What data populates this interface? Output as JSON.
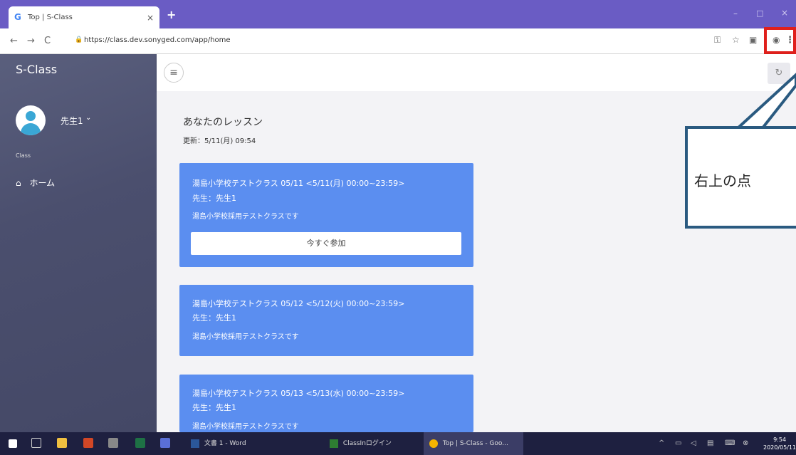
{
  "browser": {
    "tab_title": "Top | S-Class",
    "tab_favicon": "G",
    "tab_close": "×",
    "new_tab": "+",
    "url": "https://class.dev.sonyged.com/app/home",
    "minimize": "–",
    "maximize": "□",
    "close": "×"
  },
  "sidebar": {
    "brand": "S-Class",
    "username": "先生1",
    "caret": "⌄",
    "section": "Class",
    "items": [
      {
        "label": "ホーム",
        "icon": "home-icon"
      }
    ]
  },
  "main": {
    "title": "あなたのレッスン",
    "updated": "更新：5/11(月) 09:54",
    "cards": [
      {
        "title": "湯島小学校テストクラス 05/11 <5/11(月) 00:00~23:59>",
        "teacher": "先生：先生1",
        "desc": "湯島小学校採用テストクラスです",
        "join": "今すぐ参加"
      },
      {
        "title": "湯島小学校テストクラス 05/12 <5/12(火) 00:00~23:59>",
        "teacher": "先生：先生1",
        "desc": "湯島小学校採用テストクラスです"
      },
      {
        "title": "湯島小学校テストクラス 05/13 <5/13(水) 00:00~23:59>",
        "teacher": "先生：先生1",
        "desc": "湯島小学校採用テストクラスです"
      }
    ]
  },
  "callout": {
    "text": "右上の点"
  },
  "taskbar": {
    "items": [
      {
        "label": "文書 1 - Word"
      },
      {
        "label": "ClassInログイン"
      },
      {
        "label": "Top | S-Class - Goo..."
      }
    ],
    "time": "9:54",
    "date": "2020/05/11"
  },
  "colors": {
    "accent": "#5b8ef0",
    "sidebar": "#4b4f6e",
    "titlebar": "#6a5cc4",
    "highlight": "#e0201c",
    "callout_border": "#2a5a80"
  }
}
